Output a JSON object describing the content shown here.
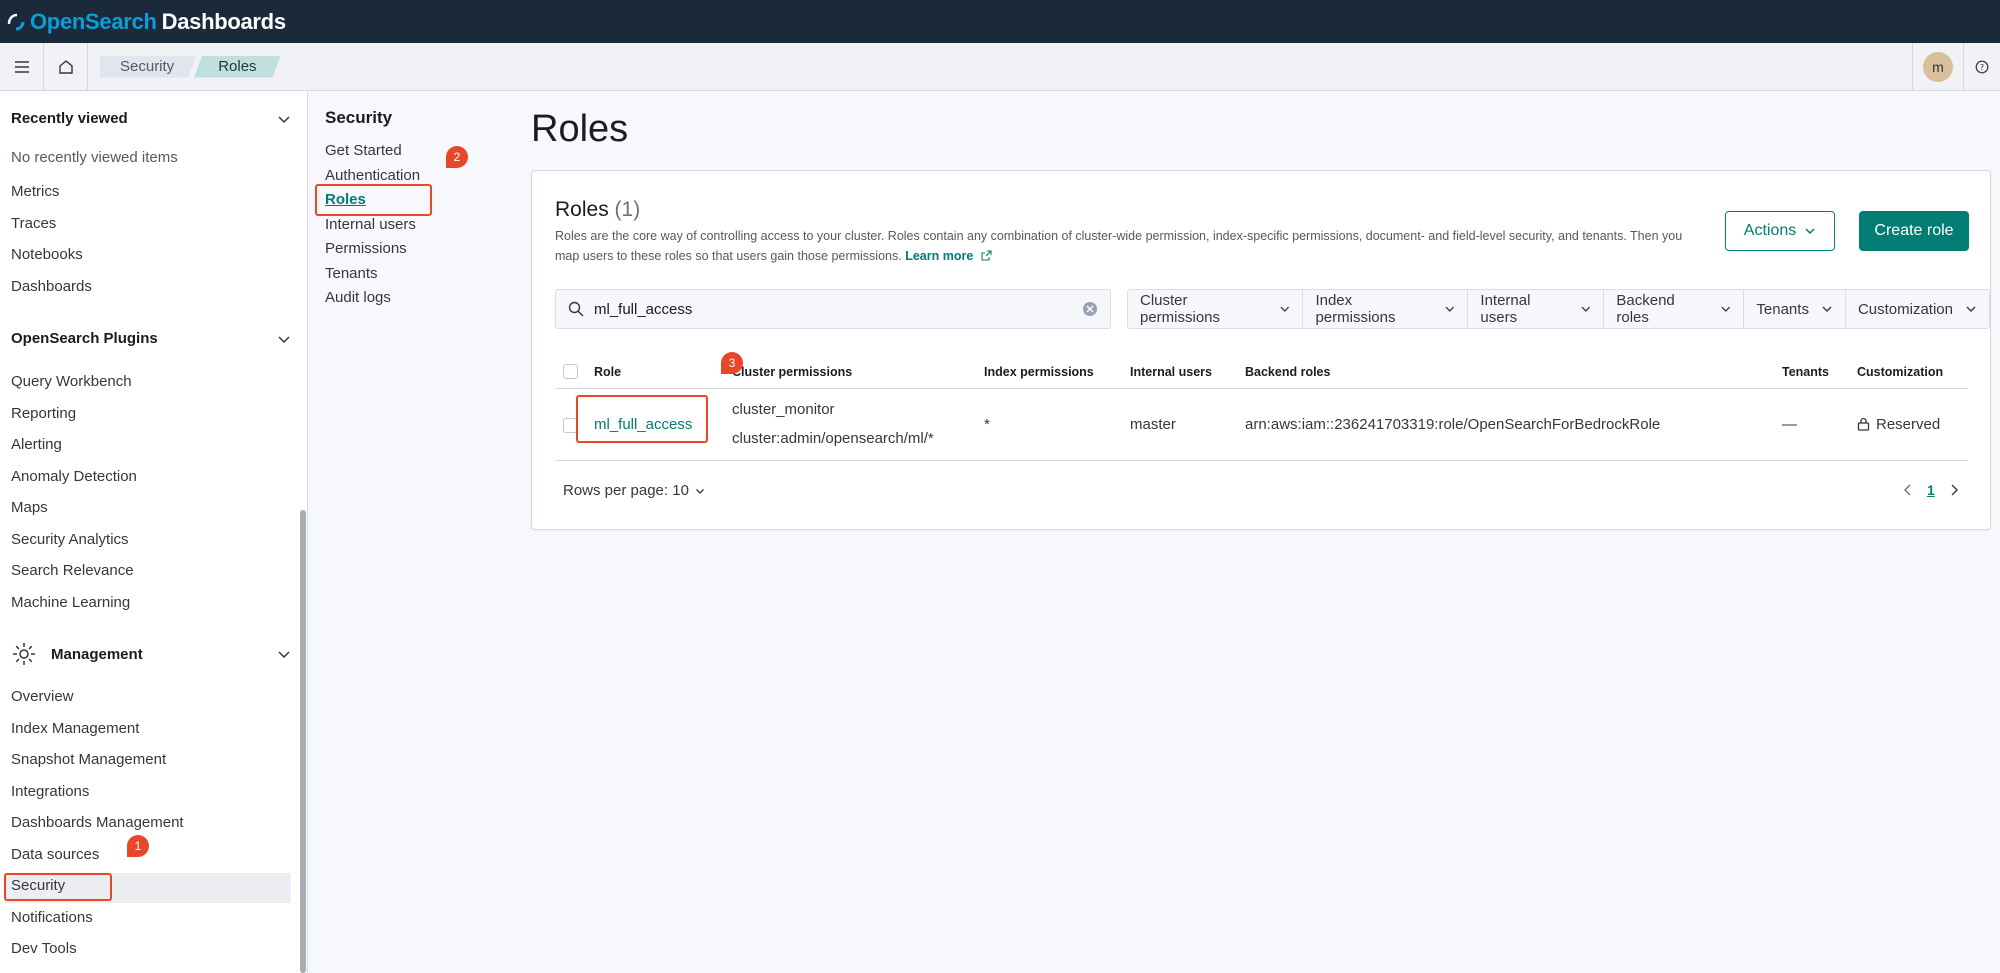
{
  "header": {
    "brand_open": "OpenSearch",
    "brand_db": "Dashboards"
  },
  "breadcrumbs": [
    "Security",
    "Roles"
  ],
  "user": {
    "avatar_initial": "m"
  },
  "leftnav": {
    "recently_viewed": {
      "title": "Recently viewed",
      "empty": "No recently viewed items"
    },
    "observability_items": [
      "Metrics",
      "Traces",
      "Notebooks",
      "Dashboards"
    ],
    "plugins": {
      "title": "OpenSearch Plugins",
      "items": [
        "Query Workbench",
        "Reporting",
        "Alerting",
        "Anomaly Detection",
        "Maps",
        "Security Analytics",
        "Search Relevance",
        "Machine Learning"
      ]
    },
    "management": {
      "title": "Management",
      "items": [
        "Overview",
        "Index Management",
        "Snapshot Management",
        "Integrations",
        "Dashboards Management",
        "Data sources",
        "Security",
        "Notifications",
        "Dev Tools"
      ]
    }
  },
  "security_nav": {
    "title": "Security",
    "items": [
      "Get Started",
      "Authentication",
      "Roles",
      "Internal users",
      "Permissions",
      "Tenants",
      "Audit logs"
    ],
    "active": "Roles"
  },
  "main": {
    "page_title": "Roles",
    "panel_title": "Roles",
    "panel_count": "(1)",
    "description": "Roles are the core way of controlling access to your cluster. Roles contain any combination of cluster-wide permission, index-specific permissions, document- and field-level security, and tenants. Then you map users to these roles so that users gain those permissions.",
    "learn_more": "Learn more",
    "actions_label": "Actions",
    "create_label": "Create role",
    "search_value": "ml_full_access",
    "filters": [
      "Cluster permissions",
      "Index permissions",
      "Internal users",
      "Backend roles",
      "Tenants",
      "Customization"
    ],
    "columns": [
      "Role",
      "Cluster permissions",
      "Index permissions",
      "Internal users",
      "Backend roles",
      "Tenants",
      "Customization"
    ],
    "rows": [
      {
        "role": "ml_full_access",
        "cluster_permissions": [
          "cluster_monitor",
          "cluster:admin/opensearch/ml/*"
        ],
        "index_permissions": "*",
        "internal_users": "master",
        "backend_roles": "arn:aws:iam::236241703319:role/OpenSearchForBedrockRole",
        "tenants": "—",
        "customization": "Reserved"
      }
    ],
    "rows_per_page": "Rows per page: 10",
    "current_page": "1"
  },
  "callouts": [
    "1",
    "2",
    "3"
  ],
  "colors": {
    "accent": "#017d73",
    "header_bg": "#1b2a3a",
    "callout": "#e8472a"
  }
}
